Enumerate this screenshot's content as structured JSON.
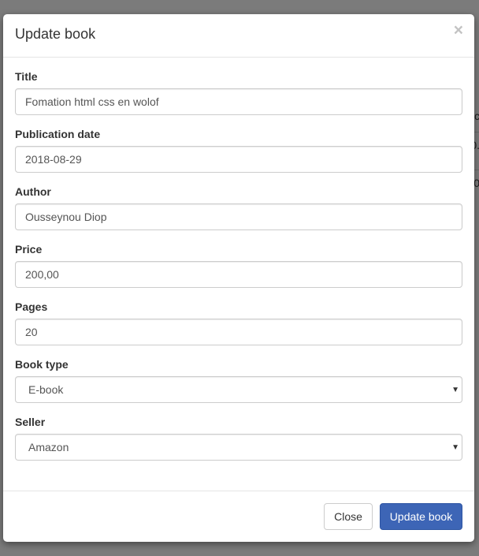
{
  "background": {
    "fragments": [
      "c",
      "0.",
      "0"
    ]
  },
  "modal": {
    "title": "Update book",
    "close_glyph": "×",
    "fields": {
      "title": {
        "label": "Title",
        "value": "Fomation html css en wolof"
      },
      "publication_date": {
        "label": "Publication date",
        "value": "2018-08-29"
      },
      "author": {
        "label": "Author",
        "value": "Ousseynou Diop"
      },
      "price": {
        "label": "Price",
        "value": "200,00"
      },
      "pages": {
        "label": "Pages",
        "value": "20"
      },
      "book_type": {
        "label": "Book type",
        "value": "E-book"
      },
      "seller": {
        "label": "Seller",
        "value": "Amazon"
      }
    },
    "footer": {
      "close_label": "Close",
      "submit_label": "Update book"
    }
  },
  "colors": {
    "overlay": "#7d7d7d",
    "primary": "#3d65b6",
    "border": "#cccccc"
  },
  "icons": {
    "close": "close-icon",
    "select_caret": "chevron-down-icon"
  }
}
